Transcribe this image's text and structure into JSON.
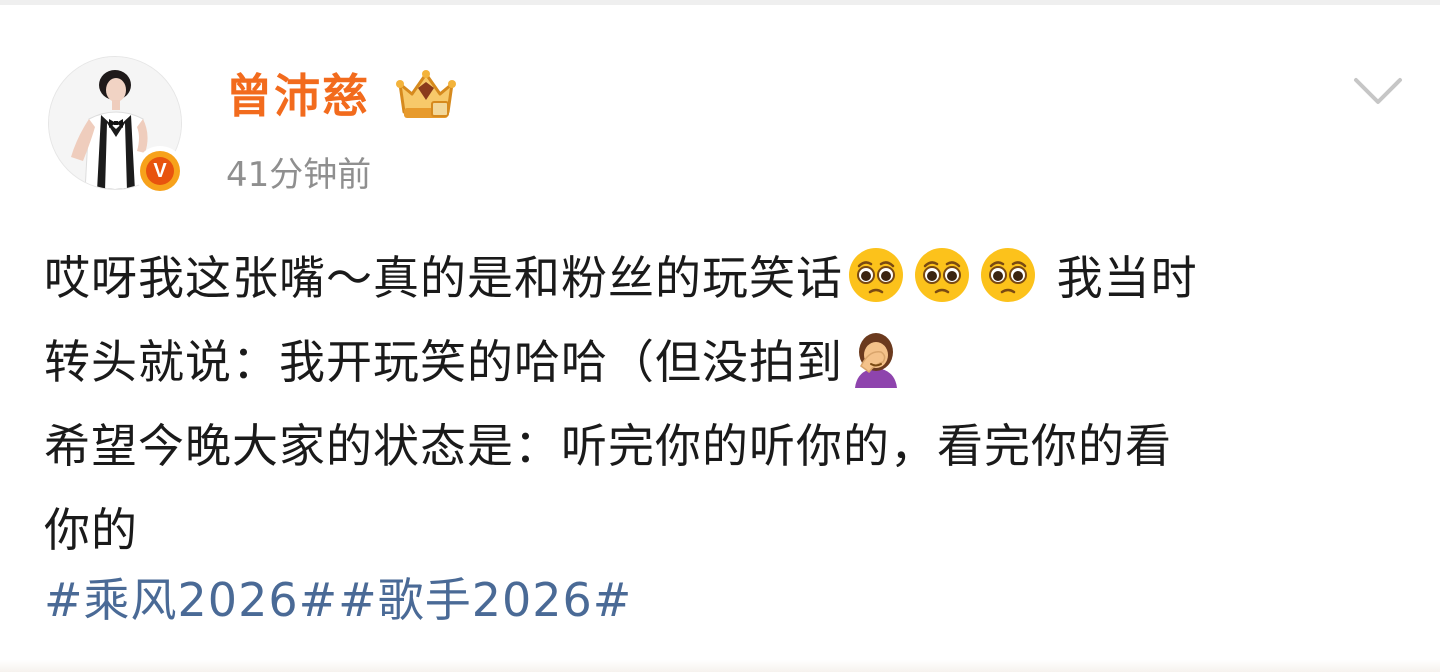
{
  "post": {
    "author": {
      "name": "曾沛慈",
      "verified_badge_letter": "V",
      "crown_icon": "vip-crown-icon"
    },
    "timestamp": "41分钟前",
    "body": {
      "line1_a": "哎呀我这张嘴～真的是和粉丝的玩笑话",
      "line1_b": "我当时",
      "line2_a": "转头就说：我开玩笑的哈哈（但没拍到",
      "line3": "希望今晚大家的状态是：听完你的听你的，看完你的看",
      "line4": "你的"
    },
    "emojis": [
      "pleading-face-icon",
      "pleading-face-icon",
      "pleading-face-icon",
      "woman-facepalming-icon"
    ],
    "hashtags": [
      "#乘风2026#",
      "#歌手2026#"
    ]
  },
  "colors": {
    "username": "#f26b1d",
    "timestamp": "#8f8f8f",
    "hashtag": "#4a6a96",
    "body_text": "#1a1a1a",
    "badge_orange": "#f7a21b"
  }
}
